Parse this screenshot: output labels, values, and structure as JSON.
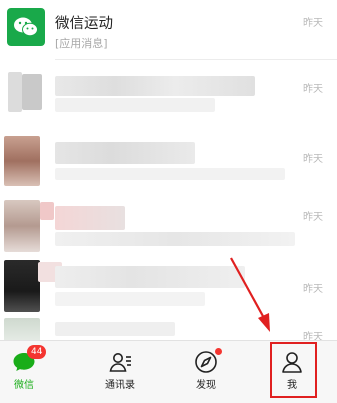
{
  "chats": [
    {
      "title": "微信运动",
      "subtitle": "[应用消息]",
      "time": "昨天"
    },
    {
      "title": "",
      "subtitle": "",
      "time": "昨天"
    },
    {
      "title": "",
      "subtitle": "",
      "time": "昨天"
    },
    {
      "title": "",
      "subtitle": "",
      "time": "昨天"
    },
    {
      "title": "",
      "subtitle": "",
      "time": "昨天"
    },
    {
      "title": "",
      "subtitle": "",
      "time": "昨天"
    }
  ],
  "tabbar": {
    "items": [
      {
        "label": "微信",
        "icon": "chat-bubble-icon",
        "badge": "44",
        "active": true
      },
      {
        "label": "通讯录",
        "icon": "contacts-icon"
      },
      {
        "label": "发现",
        "icon": "compass-icon",
        "dot": true
      },
      {
        "label": "我",
        "icon": "person-icon"
      }
    ]
  },
  "colors": {
    "wechat_green": "#1aad19",
    "badge_red": "#f43530",
    "annotation_red": "#e02020"
  }
}
